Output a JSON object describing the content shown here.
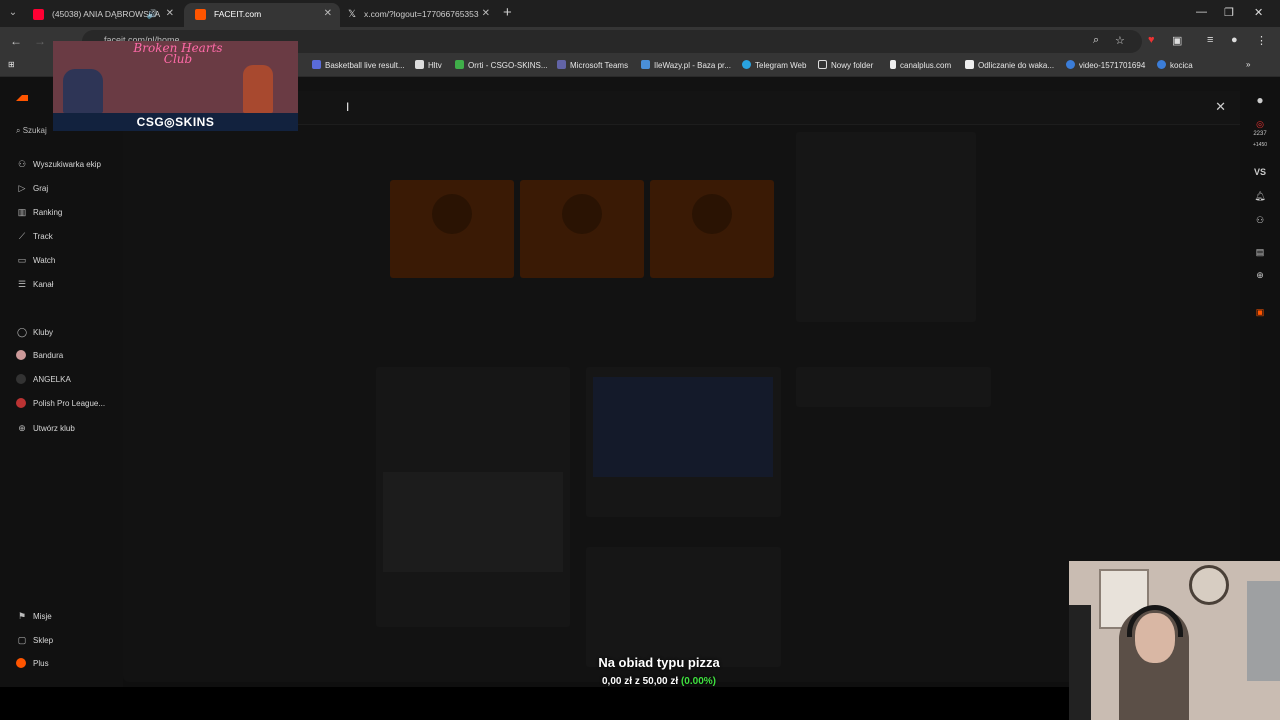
{
  "browser": {
    "tabs": [
      {
        "label": "(45038) ANIA DĄBROWSKA",
        "favicon_color": "#ff0033"
      },
      {
        "label": "FACEIT.com",
        "favicon_color": "#ff5500"
      },
      {
        "label": "x.com/?logout=177066765353",
        "favicon_color": "#000000"
      }
    ],
    "url": "faceit.com/pl/home",
    "bookmarks": [
      "Basketball live result...",
      "Hltv",
      "Orrti - CSGO-SKINS...",
      "Microsoft Teams",
      "IleWazy.pl - Baza pr...",
      "Telegram Web",
      "Nowy folder",
      "canalplus.com",
      "Odliczanie do waka...",
      "video-1571701694",
      "kocica"
    ]
  },
  "sidebar": {
    "search_label": "Szukaj",
    "nav": [
      "Wyszukiwarka ekip",
      "Graj",
      "Ranking",
      "Track",
      "Watch",
      "Kanał"
    ],
    "clubs": [
      "Kluby",
      "Bandura",
      "ANGELKA",
      "Polish Pro League...",
      "Utwórz klub"
    ],
    "bottom": [
      "Misje",
      "Sklep",
      "Plus"
    ]
  },
  "right_rail": {
    "points": "2237",
    "elo_delta": "+1450",
    "vs_label": "VS"
  },
  "promo": {
    "neon_title": "Broken Hearts Club",
    "banner": "CSG◎SKINS"
  },
  "donation": {
    "title": "Na obiad typu pizza",
    "current": "0,00 zł",
    "sep": "z",
    "goal": "50,00 zł",
    "percent": "(0.00%)"
  },
  "colors": {
    "accent": "#ff5500",
    "progress_green": "#3fe03f"
  }
}
